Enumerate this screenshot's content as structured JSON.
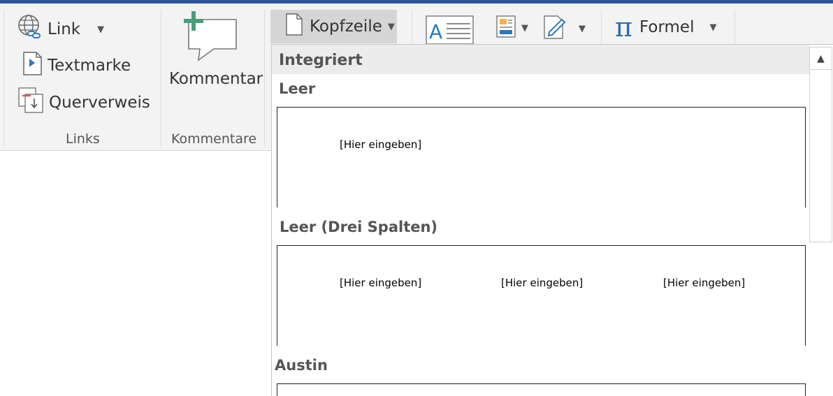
{
  "ribbon": {
    "link_label": "Link",
    "textmarke_label": "Textmarke",
    "querverweis_label": "Querverweis",
    "links_group": "Links",
    "kommentar_label": "Kommentar",
    "kommentare_group": "Kommentare",
    "kopfzeile_label": "Kopfzeile",
    "formel_label": "Formel"
  },
  "gallery": {
    "section": "Integriert",
    "items": [
      {
        "title": "Leer",
        "placeholders": [
          "[Hier eingeben]"
        ]
      },
      {
        "title": "Leer (Drei Spalten)",
        "placeholders": [
          "[Hier eingeben]",
          "[Hier eingeben]",
          "[Hier eingeben]"
        ]
      },
      {
        "title": "Austin",
        "placeholders": []
      }
    ]
  },
  "colors": {
    "accent": "#2b579a",
    "ribbon_bg": "#f3f3f3",
    "pressed": "#d5d5d5",
    "section_bg": "#ececec"
  }
}
